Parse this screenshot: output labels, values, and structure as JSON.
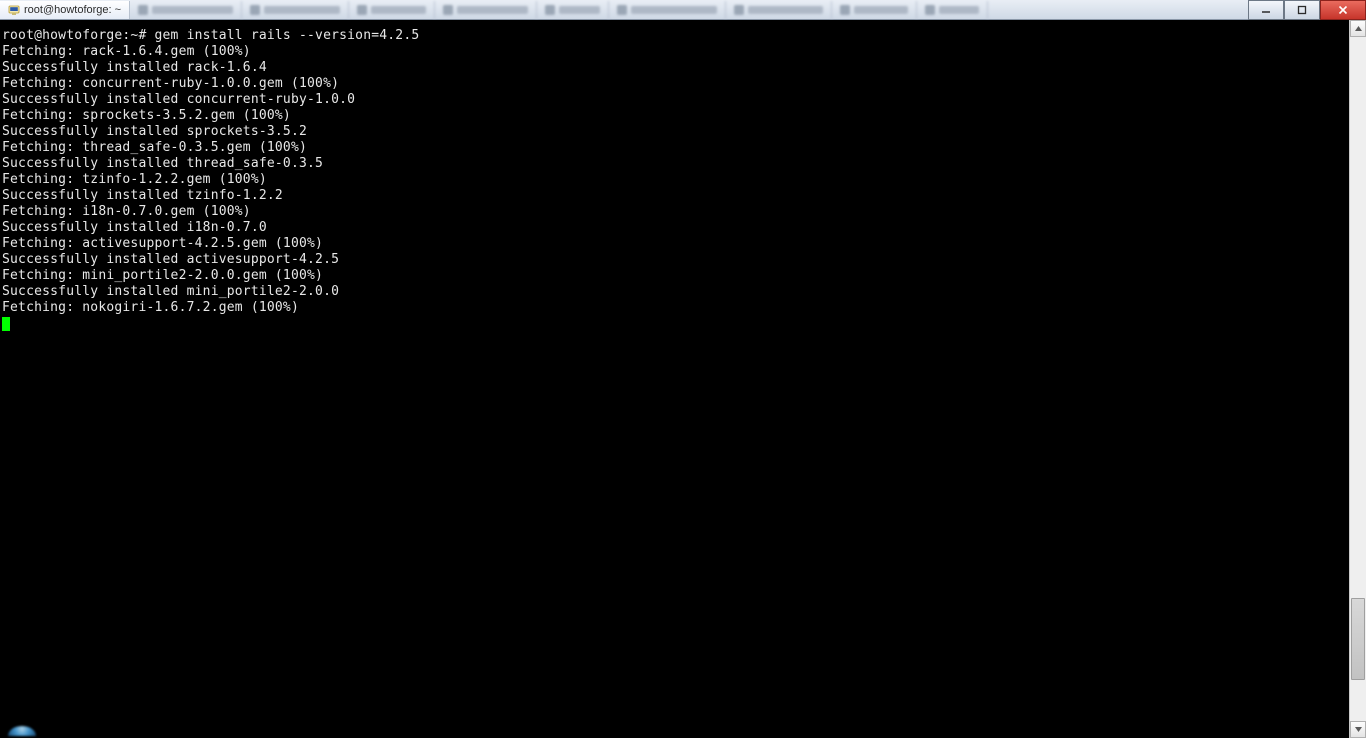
{
  "window": {
    "title": "root@howtoforge: ~"
  },
  "tabs_blurred": [
    "",
    "",
    "",
    "",
    "",
    "",
    "",
    "",
    ""
  ],
  "terminal": {
    "prompt": "root@howtoforge:~#",
    "command": "gem install rails --version=4.2.5",
    "lines": [
      "Fetching: rack-1.6.4.gem (100%)",
      "Successfully installed rack-1.6.4",
      "Fetching: concurrent-ruby-1.0.0.gem (100%)",
      "Successfully installed concurrent-ruby-1.0.0",
      "Fetching: sprockets-3.5.2.gem (100%)",
      "Successfully installed sprockets-3.5.2",
      "Fetching: thread_safe-0.3.5.gem (100%)",
      "Successfully installed thread_safe-0.3.5",
      "Fetching: tzinfo-1.2.2.gem (100%)",
      "Successfully installed tzinfo-1.2.2",
      "Fetching: i18n-0.7.0.gem (100%)",
      "Successfully installed i18n-0.7.0",
      "Fetching: activesupport-4.2.5.gem (100%)",
      "Successfully installed activesupport-4.2.5",
      "Fetching: mini_portile2-2.0.0.gem (100%)",
      "Successfully installed mini_portile2-2.0.0",
      "Fetching: nokogiri-1.6.7.2.gem (100%)"
    ]
  },
  "window_controls": {
    "minimize": "–",
    "maximize": "☐",
    "close": "✕"
  }
}
